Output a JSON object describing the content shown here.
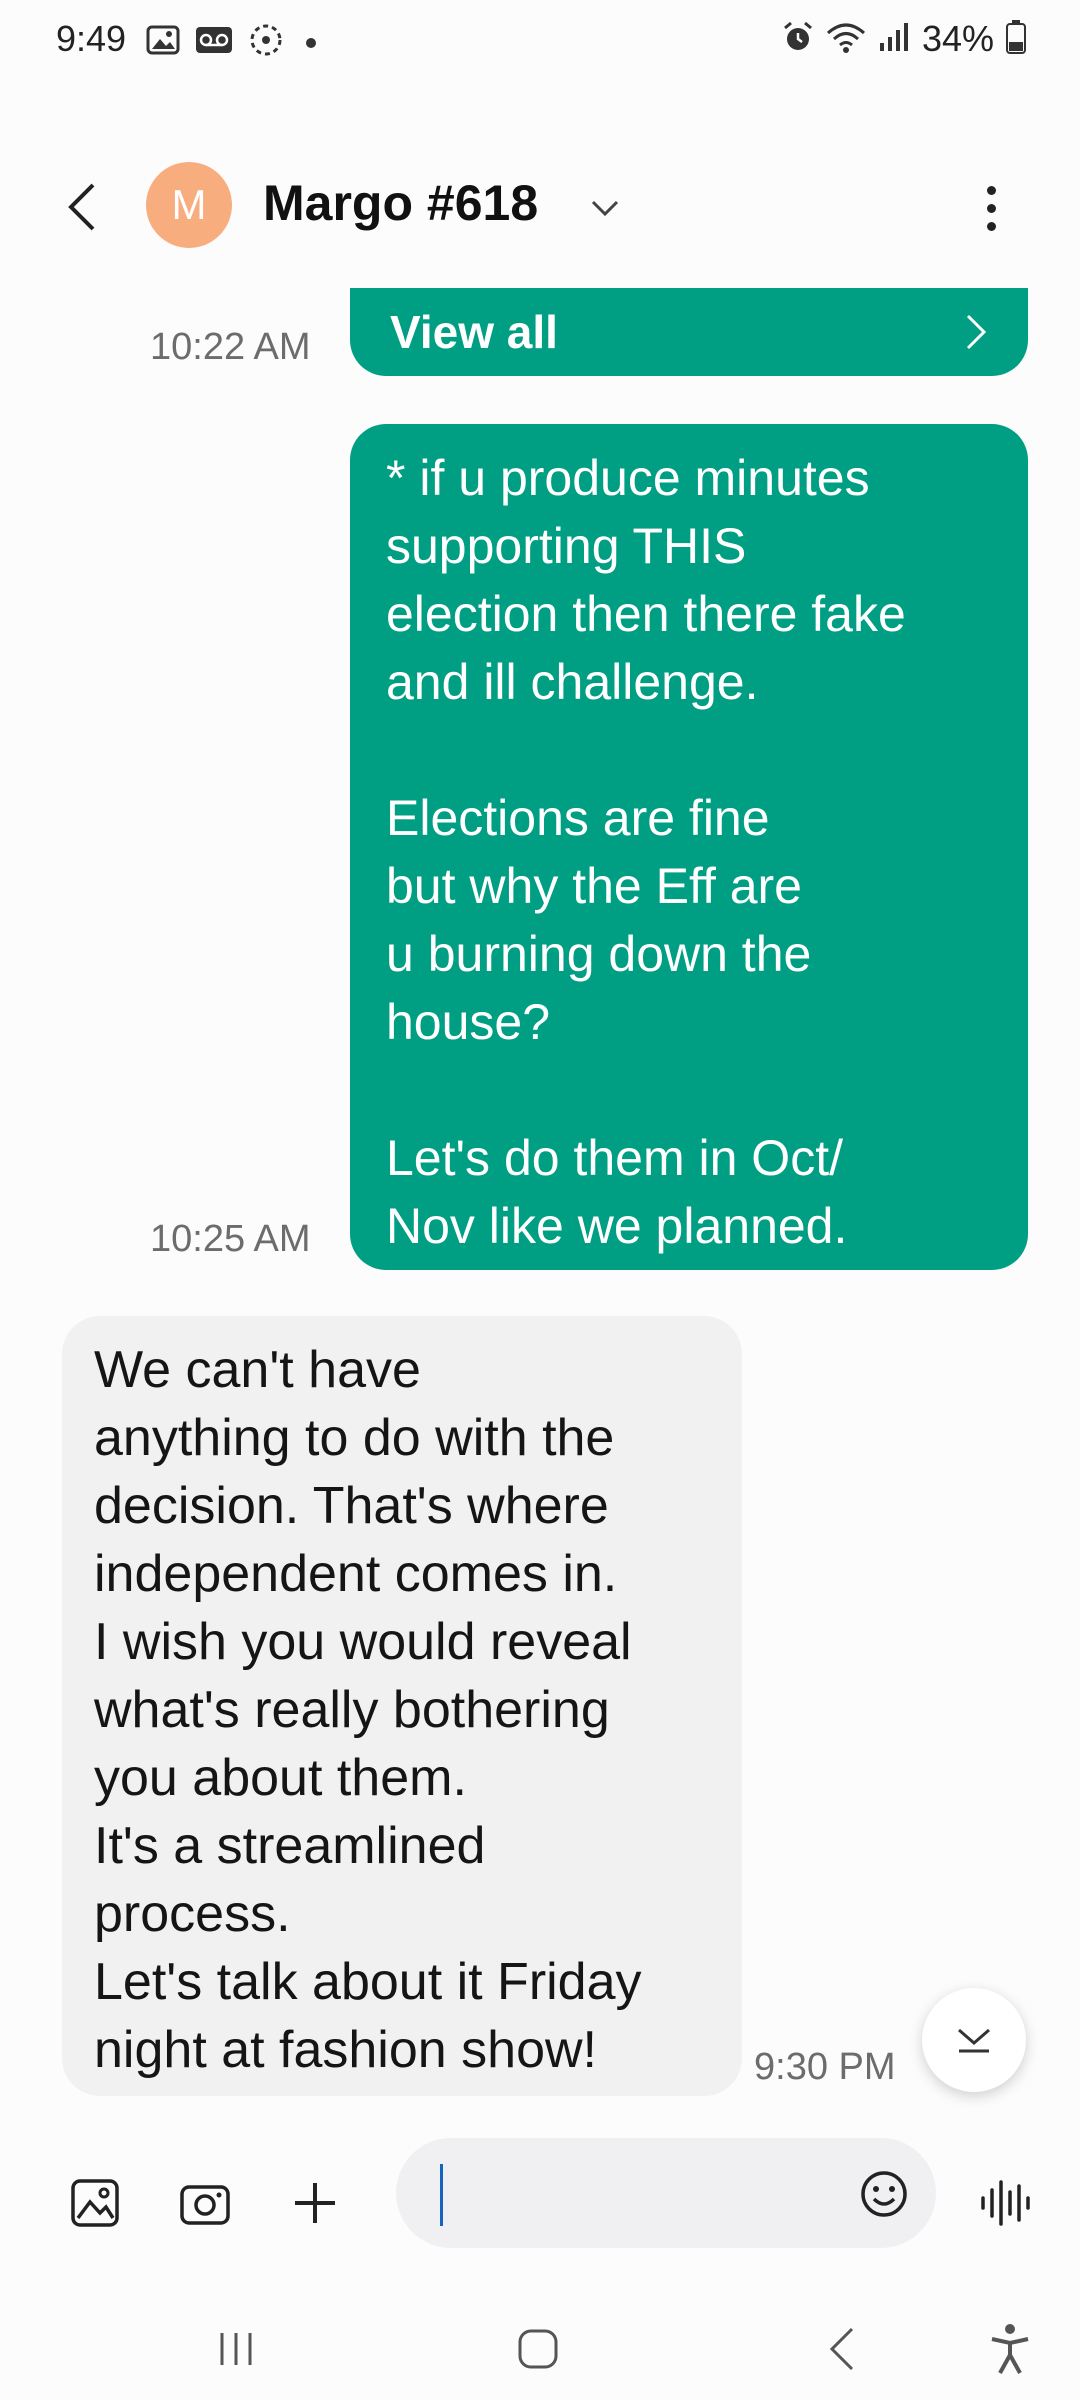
{
  "status_bar": {
    "time": "9:49",
    "battery": "34%",
    "left_icons": [
      "image-icon",
      "voicemail-icon",
      "sync-icon",
      "dot-icon"
    ],
    "right_icons": [
      "alarm-icon",
      "wifi-icon",
      "signal-icon",
      "battery-icon"
    ]
  },
  "header": {
    "avatar_initial": "M",
    "avatar_color": "#f8ad7f",
    "contact_name": "Margo #618"
  },
  "messages": {
    "mms": {
      "time": "10:22 AM",
      "view_all_label": "View all"
    },
    "sent": {
      "time": "10:25 AM",
      "paragraphs": [
        "* if u produce minutes\nsupporting THIS\nelection then there fake\nand ill challenge.",
        "Elections are fine\nbut why the Eff are\nu burning down the\nhouse?",
        "Let's do them in Oct/\nNov like we planned."
      ]
    },
    "received": {
      "time": "9:30 PM",
      "text": "We can't have\nanything to do with the\ndecision. That's where\nindependent comes in.\nI wish you would reveal\nwhat's really bothering\nyou about them.\nIt's a streamlined\nprocess.\nLet's talk about it Friday\nnight at fashion show!"
    }
  },
  "composer": {
    "input_value": "",
    "icons": [
      "gallery-icon",
      "camera-icon",
      "plus-icon",
      "emoji-icon",
      "voice-icon"
    ]
  },
  "colors": {
    "sent_bubble": "#009f84",
    "received_bubble": "#f1f1f2",
    "cursor": "#1565c0"
  }
}
